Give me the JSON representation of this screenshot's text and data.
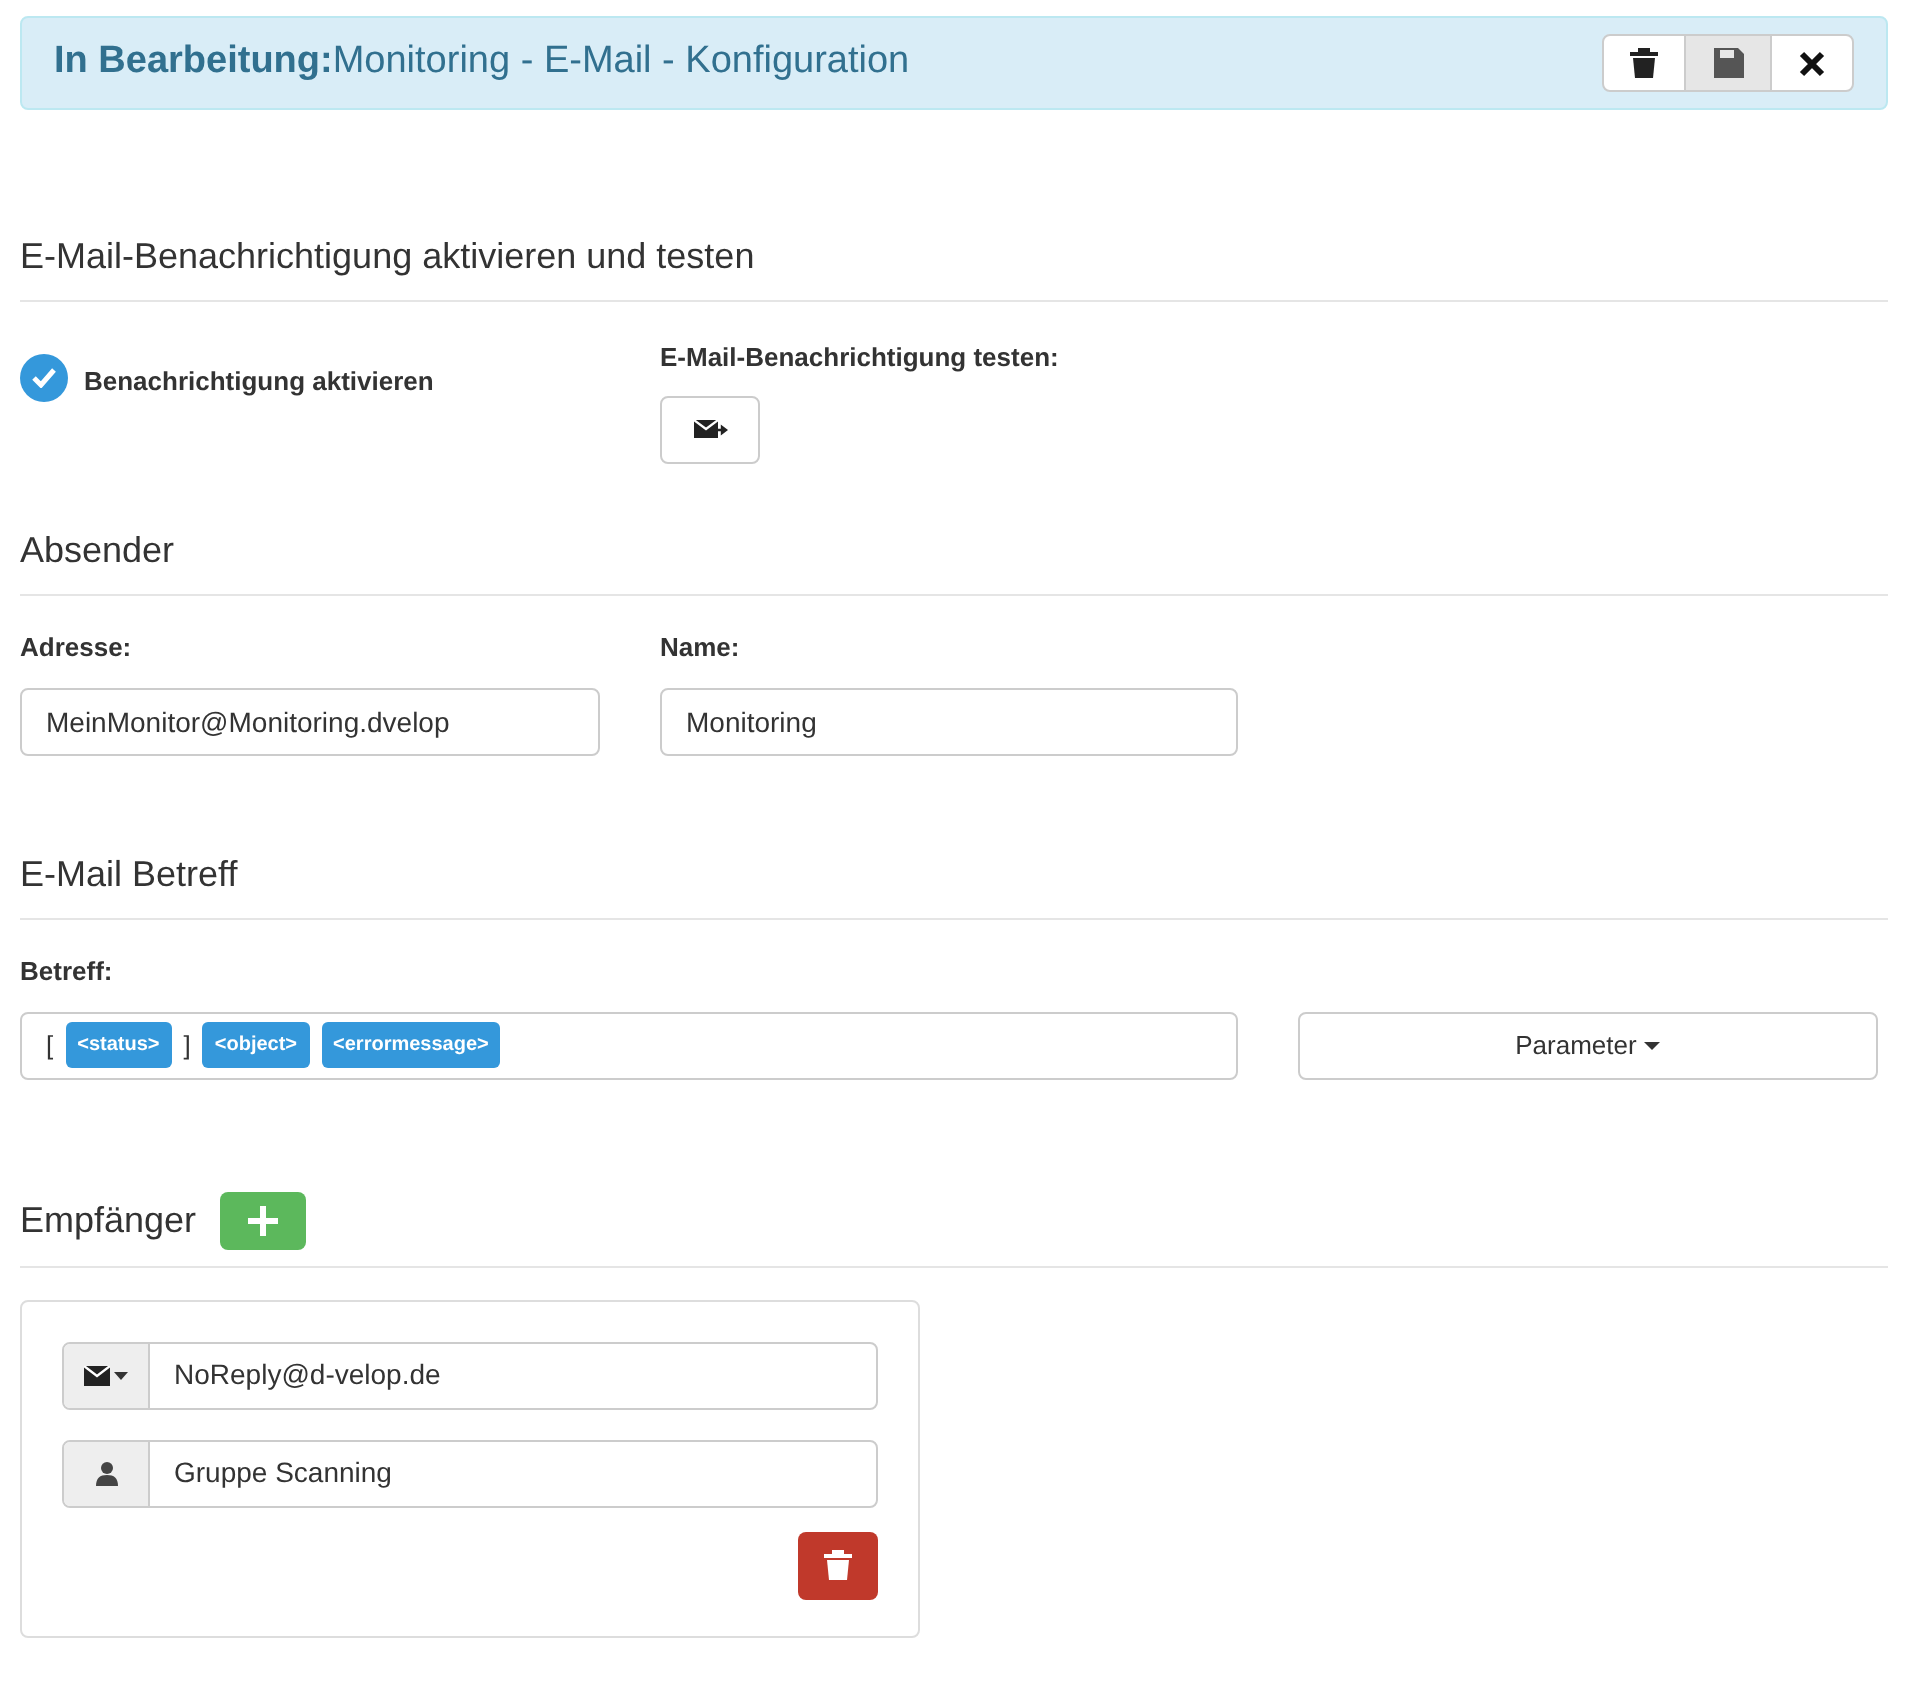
{
  "header": {
    "status": "In Bearbeitung:",
    "title": "Monitoring  -  E-Mail - Konfiguration"
  },
  "activation": {
    "heading": "E-Mail-Benachrichtigung aktivieren und testen",
    "checkbox_label": "Benachrichtigung aktivieren",
    "checked": true,
    "test_label": "E-Mail-Benachrichtigung testen:"
  },
  "sender": {
    "heading": "Absender",
    "address_label": "Adresse:",
    "address": "MeinMonitor@Monitoring.dvelop",
    "name_label": "Name:",
    "name": "Monitoring"
  },
  "subject": {
    "heading": "E-Mail Betreff",
    "label": "Betreff:",
    "tokens": [
      {
        "kind": "text",
        "text": "["
      },
      {
        "kind": "tag",
        "text": "<status>"
      },
      {
        "kind": "text",
        "text": "]"
      },
      {
        "kind": "tag",
        "text": "<object>"
      },
      {
        "kind": "tag",
        "text": "<errormessage>"
      }
    ],
    "parameter_button": "Parameter"
  },
  "recipients": {
    "heading": "Empfänger",
    "items": [
      {
        "address": "NoReply@d-velop.de",
        "group": "Gruppe Scanning"
      }
    ]
  }
}
